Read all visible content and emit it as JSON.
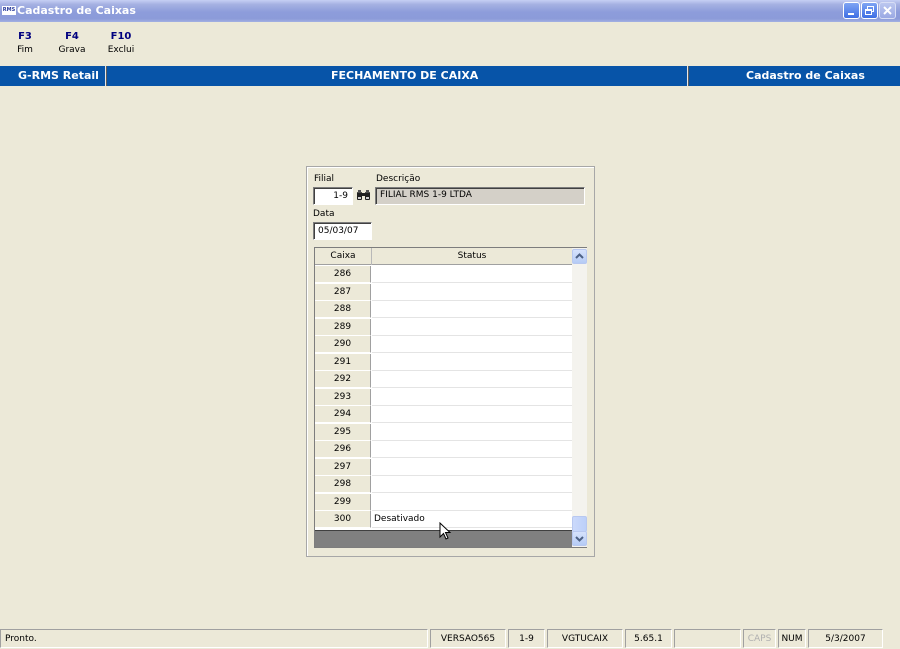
{
  "window": {
    "app_icon_text": "RMS",
    "title": "Cadastro de Caixas"
  },
  "toolbar": {
    "keys": [
      {
        "key": "F3",
        "label": "Fim"
      },
      {
        "key": "F4",
        "label": "Grava"
      },
      {
        "key": "F10",
        "label": "Exclui"
      }
    ]
  },
  "header": {
    "left": "G-RMS Retail",
    "center": "FECHAMENTO DE CAIXA",
    "right": "Cadastro de Caixas"
  },
  "form": {
    "filial_label": "Filial",
    "filial_value": "1-9",
    "descricao_label": "Descrição",
    "descricao_value": "FILIAL RMS 1-9 LTDA",
    "data_label": "Data",
    "data_value": "05/03/07"
  },
  "grid": {
    "columns": [
      "Caixa",
      "Status"
    ],
    "rows": [
      {
        "caixa": "286",
        "status": ""
      },
      {
        "caixa": "287",
        "status": ""
      },
      {
        "caixa": "288",
        "status": ""
      },
      {
        "caixa": "289",
        "status": ""
      },
      {
        "caixa": "290",
        "status": ""
      },
      {
        "caixa": "291",
        "status": ""
      },
      {
        "caixa": "292",
        "status": ""
      },
      {
        "caixa": "293",
        "status": ""
      },
      {
        "caixa": "294",
        "status": ""
      },
      {
        "caixa": "295",
        "status": ""
      },
      {
        "caixa": "296",
        "status": ""
      },
      {
        "caixa": "297",
        "status": ""
      },
      {
        "caixa": "298",
        "status": ""
      },
      {
        "caixa": "299",
        "status": ""
      },
      {
        "caixa": "300",
        "status": "Desativado"
      }
    ]
  },
  "statusbar": {
    "message": "Pronto.",
    "version": "VERSAO565",
    "filial": "1-9",
    "program": "VGTUCAIX",
    "build": "5.65.1",
    "empty": "",
    "caps": "CAPS",
    "num": "NUM",
    "date": "5/3/2007"
  }
}
